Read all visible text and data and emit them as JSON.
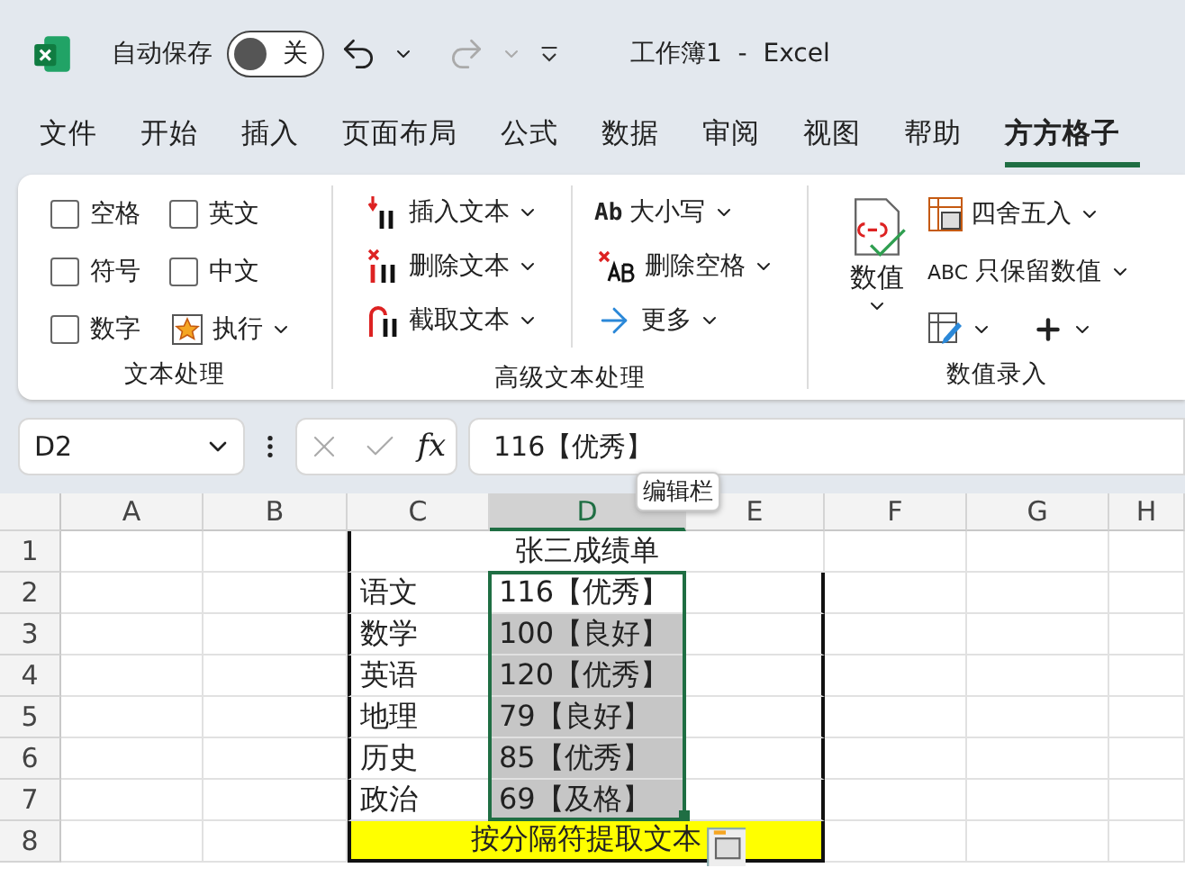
{
  "titlebar": {
    "autosave_label": "自动保存",
    "autosave": {
      "on": false,
      "label": "关"
    },
    "title": "工作簿1  -  Excel"
  },
  "tabs": [
    {
      "label": "文件",
      "selected": false
    },
    {
      "label": "开始",
      "selected": false
    },
    {
      "label": "插入",
      "selected": false
    },
    {
      "label": "页面布局",
      "selected": false
    },
    {
      "label": "公式",
      "selected": false
    },
    {
      "label": "数据",
      "selected": false
    },
    {
      "label": "审阅",
      "selected": false
    },
    {
      "label": "视图",
      "selected": false
    },
    {
      "label": "帮助",
      "selected": false
    },
    {
      "label": "方方格子",
      "selected": true
    }
  ],
  "ribbon": {
    "groups": [
      {
        "label": "文本处理",
        "checkboxes": [
          {
            "label": "空格",
            "checked": false
          },
          {
            "label": "英文",
            "checked": false
          },
          {
            "label": "符号",
            "checked": false
          },
          {
            "label": "中文",
            "checked": false
          },
          {
            "label": "数字",
            "checked": false
          }
        ],
        "run_button": "执行"
      },
      {
        "label": "高级文本处理",
        "commands": [
          {
            "label": "插入文本",
            "kind": "insert"
          },
          {
            "label": "删除文本",
            "kind": "delete"
          },
          {
            "label": "截取文本",
            "kind": "cut"
          },
          {
            "label": "大小写",
            "kind": "case",
            "icon_text": "Ab"
          },
          {
            "label": "删除空格",
            "kind": "space"
          },
          {
            "label": "更多",
            "kind": "more"
          }
        ]
      },
      {
        "label": "数值录入",
        "big_button": "数值",
        "commands": [
          {
            "label": "四舍五入",
            "kind": "round"
          },
          {
            "label": "只保留数值",
            "kind": "keep",
            "icon_text": "ABC"
          }
        ]
      }
    ]
  },
  "formula_bar": {
    "name_box": "D2",
    "fx": "fx",
    "value": "116【优秀】",
    "tooltip": "编辑栏"
  },
  "sheet": {
    "columns": [
      {
        "label": "A",
        "selected": false
      },
      {
        "label": "B",
        "selected": false
      },
      {
        "label": "C",
        "selected": false
      },
      {
        "label": "D",
        "selected": true
      },
      {
        "label": "E",
        "selected": false
      },
      {
        "label": "F",
        "selected": false
      },
      {
        "label": "G",
        "selected": false
      },
      {
        "label": "H",
        "selected": false
      }
    ],
    "rows": [
      {
        "number": "1",
        "kind": "title",
        "text": "张三成绩单"
      },
      {
        "number": "2",
        "kind": "data",
        "subject": "语文",
        "score": "116【优秀】",
        "selected": true,
        "active": true
      },
      {
        "number": "3",
        "kind": "data",
        "subject": "数学",
        "score": "100【良好】",
        "selected": true,
        "active": false
      },
      {
        "number": "4",
        "kind": "data",
        "subject": "英语",
        "score": "120【优秀】",
        "selected": true,
        "active": false
      },
      {
        "number": "5",
        "kind": "data",
        "subject": "地理",
        "score": "79【良好】",
        "selected": true,
        "active": false
      },
      {
        "number": "6",
        "kind": "data",
        "subject": "历史",
        "score": "85【优秀】",
        "selected": true,
        "active": false
      },
      {
        "number": "7",
        "kind": "data",
        "subject": "政治",
        "score": "69【及格】",
        "selected": true,
        "active": false
      },
      {
        "number": "8",
        "kind": "footer",
        "text": "按分隔符提取文本"
      }
    ]
  }
}
